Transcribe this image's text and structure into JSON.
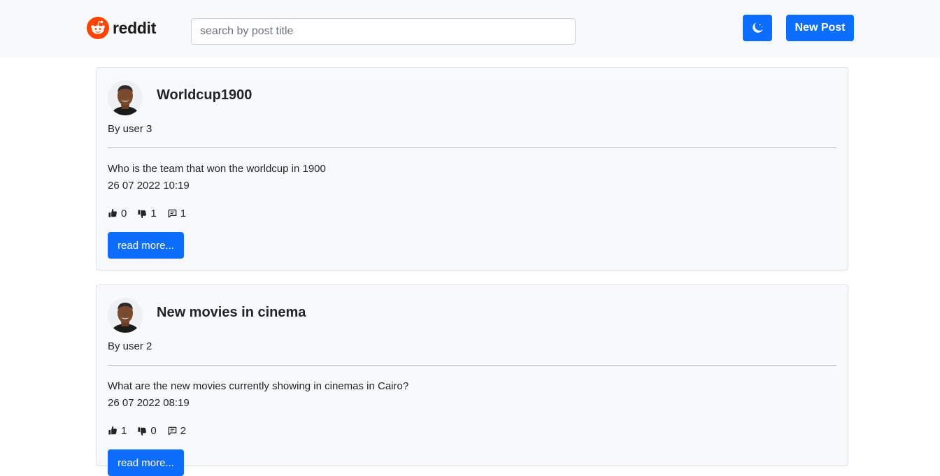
{
  "header": {
    "logo_text": "reddit",
    "search_placeholder": "search by post title",
    "theme_toggle_icon": "moon-stars-icon",
    "new_post_label": "New Post",
    "accent_color": "#0d6efd",
    "logo_color": "#ff4500"
  },
  "posts": [
    {
      "title": "Worldcup1900",
      "author": "By user 3",
      "body": "Who is the team that won the worldcup in 1900",
      "date": "26 07 2022 10:19",
      "likes": "0",
      "dislikes": "1",
      "comments": "1",
      "read_more_label": "read more..."
    },
    {
      "title": "New movies in cinema",
      "author": "By user 2",
      "body": "What are the new movies currently showing in cinemas in Cairo?",
      "date": "26 07 2022 08:19",
      "likes": "1",
      "dislikes": "0",
      "comments": "2",
      "read_more_label": "read more..."
    }
  ]
}
